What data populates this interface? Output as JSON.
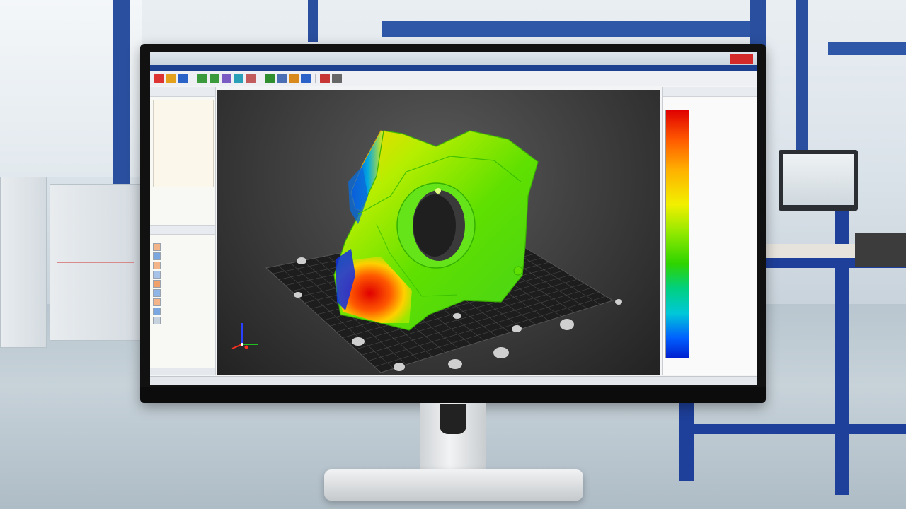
{
  "app": {
    "title": "",
    "brand_badge": "",
    "status": ""
  },
  "toolbar": {
    "buttons": [
      {
        "icon": "new-file-icon",
        "color": "#d33"
      },
      {
        "icon": "open-icon",
        "color": "#e4a21c"
      },
      {
        "icon": "save-icon",
        "color": "#2a62c8"
      },
      {
        "icon": "undo-icon",
        "color": "#3b9a3b"
      },
      {
        "icon": "redo-icon",
        "color": "#3b9a3b"
      },
      {
        "icon": "cut-icon",
        "color": "#7a5cc2"
      },
      {
        "icon": "copy-icon",
        "color": "#2a9fb8"
      },
      {
        "icon": "paste-icon",
        "color": "#c25c5c"
      },
      {
        "icon": "rotate-icon",
        "color": "#2f8f2f"
      },
      {
        "icon": "zoom-icon",
        "color": "#4a6fb5"
      },
      {
        "icon": "pan-icon",
        "color": "#d98a1c"
      },
      {
        "icon": "mesh-icon",
        "color": "#2a62c8"
      },
      {
        "icon": "analyze-icon",
        "color": "#c73535"
      },
      {
        "icon": "settings-icon",
        "color": "#666"
      }
    ]
  },
  "left_panel": {
    "header": "",
    "tree_items": [
      "",
      "",
      "",
      "",
      "",
      "",
      "",
      "",
      "",
      "",
      ""
    ],
    "props": [
      [
        "",
        ""
      ],
      [
        "",
        ""
      ],
      [
        "",
        ""
      ]
    ],
    "section2_title": "",
    "list_items": [
      "",
      "",
      "",
      "",
      "",
      "",
      "",
      "",
      ""
    ]
  },
  "legend": {
    "header": "",
    "ticks": [
      "",
      "",
      "",
      "",
      "",
      "",
      "",
      "",
      "",
      ""
    ],
    "footer": ""
  },
  "colors": {
    "accent": "#1d3f8f",
    "viewport_bg": "#333333",
    "model_green": "#5fe000",
    "model_red": "#e81a00",
    "model_blue": "#1030e0"
  }
}
